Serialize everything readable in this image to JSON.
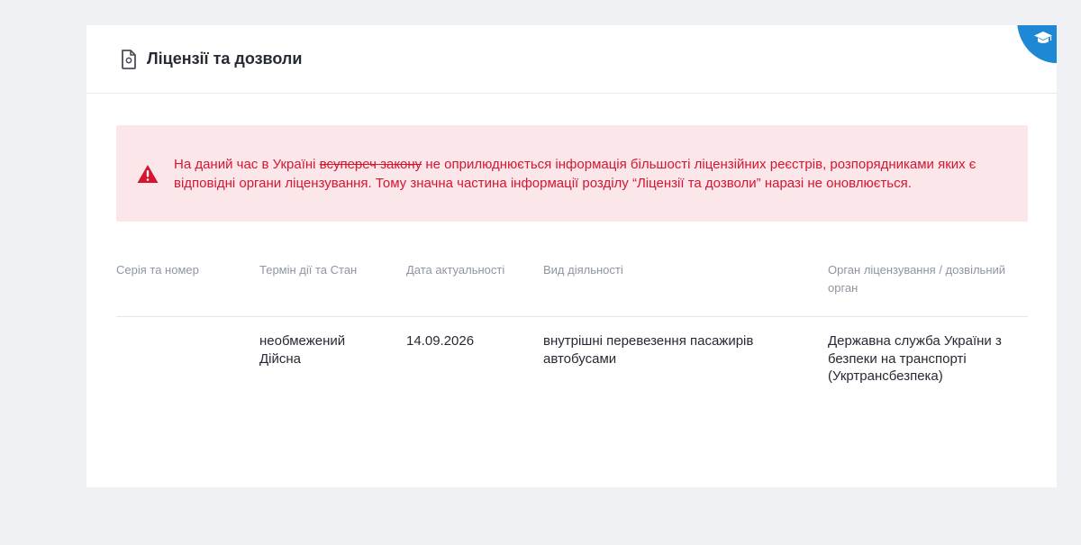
{
  "section": {
    "title": "Ліцензії та дозволи",
    "header_icon": "license-document-icon",
    "badge_icon": "graduation-cap-icon"
  },
  "alert": {
    "icon": "warning-triangle-icon",
    "text_before": "На даний час в Україні ",
    "text_struck": "всупереч закону",
    "text_after": " не оприлюднюється інформація більшості ліцензійних реєстрів, розпорядниками яких є відповідні органи ліцензування. Тому значна частина інформації розділу “Ліцензії та дозволи” наразі не оновлюється."
  },
  "table": {
    "headers": {
      "series": "Серія та номер",
      "term": "Термін дії та Стан",
      "date": "Дата актуальності",
      "activity": "Вид діяльності",
      "authority": "Орган ліцензування / дозвільний орган"
    },
    "rows": [
      {
        "series": "",
        "term": "необмежений",
        "status": "Дійсна",
        "date": "14.09.2026",
        "activity": "внутрішні перевезення пасажирів автобусами",
        "authority": "Державна служба України з безпеки на транспорті (Укртрансбезпека)"
      }
    ]
  },
  "colors": {
    "page_background": "#eff1f5",
    "alert_background": "#fbe7ea",
    "alert_text": "#d6152f",
    "badge": "#1e88d4"
  }
}
